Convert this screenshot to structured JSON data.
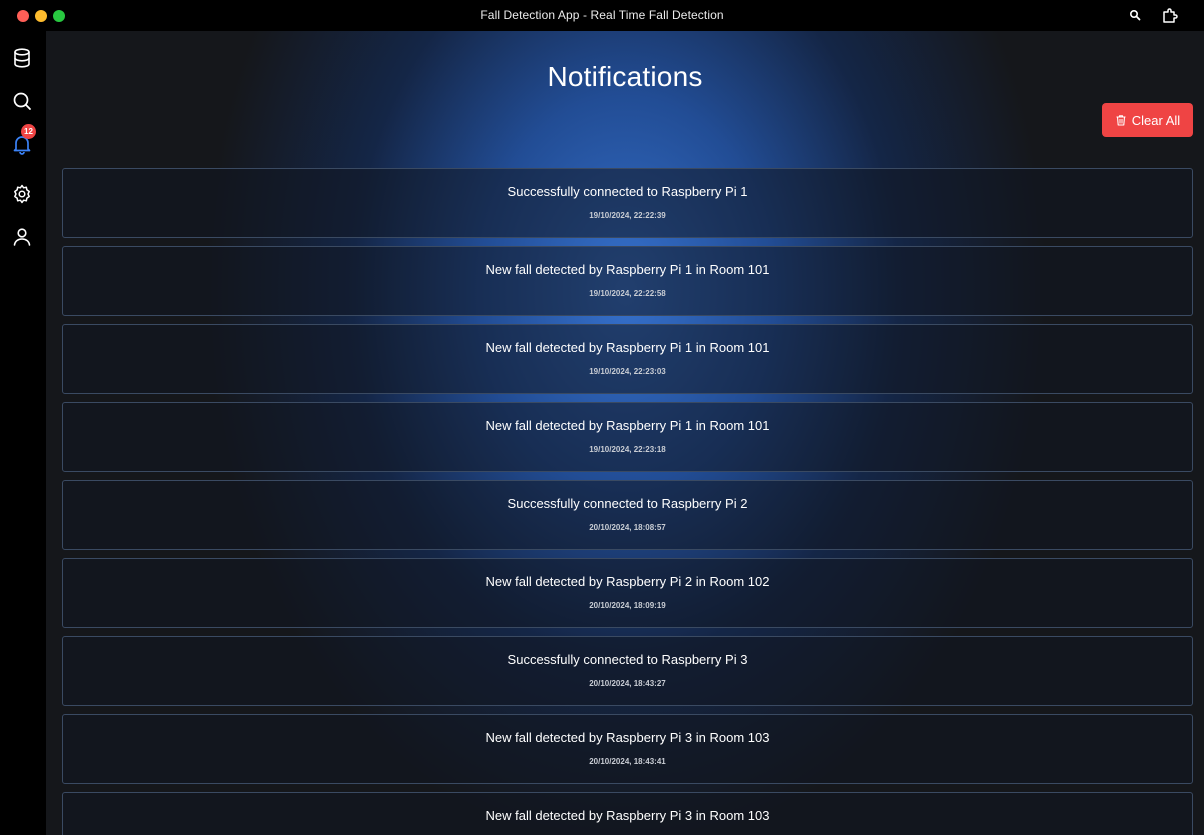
{
  "window": {
    "title": "Fall Detection App - Real Time Fall Detection",
    "controls": [
      "close",
      "minimize",
      "maximize"
    ]
  },
  "titlebar_icons": [
    "search-icon",
    "extension-icon"
  ],
  "sidebar": {
    "items": [
      {
        "name": "database",
        "icon": "database-icon"
      },
      {
        "name": "search",
        "icon": "search-icon"
      },
      {
        "name": "notifications",
        "icon": "bell-icon",
        "badge": "12",
        "active_color": "#3b82f6"
      },
      {
        "name": "settings",
        "icon": "gear-icon"
      },
      {
        "name": "profile",
        "icon": "user-icon"
      }
    ]
  },
  "page": {
    "title": "Notifications",
    "clear_all_label": "Clear All",
    "clear_all_icon": "trash-icon",
    "accent_color": "#ef4444"
  },
  "notifications": [
    {
      "message": "Successfully connected to Raspberry Pi 1",
      "time": "19/10/2024, 22:22:39"
    },
    {
      "message": "New fall detected by Raspberry Pi 1 in Room 101",
      "time": "19/10/2024, 22:22:58"
    },
    {
      "message": "New fall detected by Raspberry Pi 1 in Room 101",
      "time": "19/10/2024, 22:23:03"
    },
    {
      "message": "New fall detected by Raspberry Pi 1 in Room 101",
      "time": "19/10/2024, 22:23:18"
    },
    {
      "message": "Successfully connected to Raspberry Pi 2",
      "time": "20/10/2024, 18:08:57"
    },
    {
      "message": "New fall detected by Raspberry Pi 2 in Room 102",
      "time": "20/10/2024, 18:09:19"
    },
    {
      "message": "Successfully connected to Raspberry Pi 3",
      "time": "20/10/2024, 18:43:27"
    },
    {
      "message": "New fall detected by Raspberry Pi 3 in Room 103",
      "time": "20/10/2024, 18:43:41"
    },
    {
      "message": "New fall detected by Raspberry Pi 3 in Room 103",
      "time": ""
    }
  ]
}
